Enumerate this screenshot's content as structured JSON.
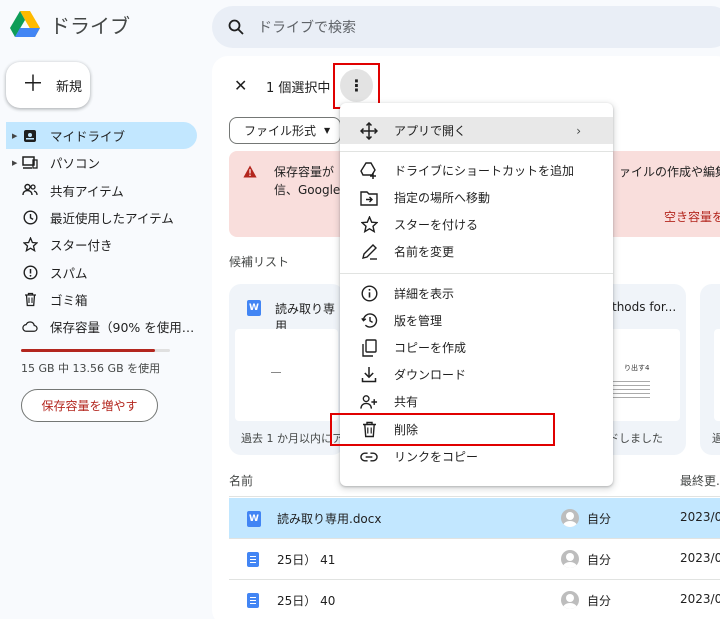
{
  "app": {
    "title": "ドライブ"
  },
  "search": {
    "placeholder": "ドライブで検索"
  },
  "new_button": {
    "label": "新規"
  },
  "sidebar": {
    "items": [
      {
        "label": "マイドライブ"
      },
      {
        "label": "パソコン"
      },
      {
        "label": "共有アイテム"
      },
      {
        "label": "最近使用したアイテム"
      },
      {
        "label": "スター付き"
      },
      {
        "label": "スパム"
      },
      {
        "label": "ゴミ箱"
      },
      {
        "label": "保存容量（90% を使用…"
      }
    ],
    "storage_used_fraction": 0.9,
    "storage_text": "15 GB 中 13.56 GB を使用",
    "more_storage_label": "保存容量を増やす"
  },
  "selection": {
    "count_label": "1 個選択中"
  },
  "filter": {
    "label": "ファイル形式"
  },
  "warning": {
    "line1": "保存容量が",
    "line2": "信、Google",
    "line1_right": "ァイルの作成や編集",
    "link": "空き容量を"
  },
  "suggested": {
    "label": "候補リスト",
    "cards": [
      {
        "title": "読み取り専用",
        "footer": "過去 1 か月以内にア"
      },
      {
        "title": "thods for...",
        "footer": "ドしました"
      },
      {
        "title": "",
        "footer": "過"
      }
    ]
  },
  "list": {
    "header_name": "名前",
    "header_modified": "最終更...",
    "rows": [
      {
        "name": "読み取り専用.docx",
        "owner": "自分",
        "date": "2023/0"
      },
      {
        "name": "25日） 41",
        "owner": "自分",
        "date": "2023/0"
      },
      {
        "name": "25日） 40",
        "owner": "自分",
        "date": "2023/0"
      }
    ]
  },
  "menu": {
    "items": [
      {
        "label": "アプリで開く",
        "icon": "move-icon",
        "arrow": "›"
      },
      {
        "label": "ドライブにショートカットを追加",
        "icon": "add-shortcut-icon"
      },
      {
        "label": "指定の場所へ移動",
        "icon": "move-to-folder-icon"
      },
      {
        "label": "スターを付ける",
        "icon": "star-icon"
      },
      {
        "label": "名前を変更",
        "icon": "rename-icon"
      },
      {
        "label": "詳細を表示",
        "icon": "info-icon"
      },
      {
        "label": "版を管理",
        "icon": "history-icon"
      },
      {
        "label": "コピーを作成",
        "icon": "copy-icon"
      },
      {
        "label": "ダウンロード",
        "icon": "download-icon"
      },
      {
        "label": "共有",
        "icon": "share-icon"
      },
      {
        "label": "削除",
        "icon": "trash-icon"
      },
      {
        "label": "リンクをコピー",
        "icon": "link-icon"
      }
    ]
  },
  "colors": {
    "accent": "#c2e7ff",
    "warning_bg": "#f9dedc",
    "highlight_red": "#e00000",
    "danger": "#b3261e"
  }
}
